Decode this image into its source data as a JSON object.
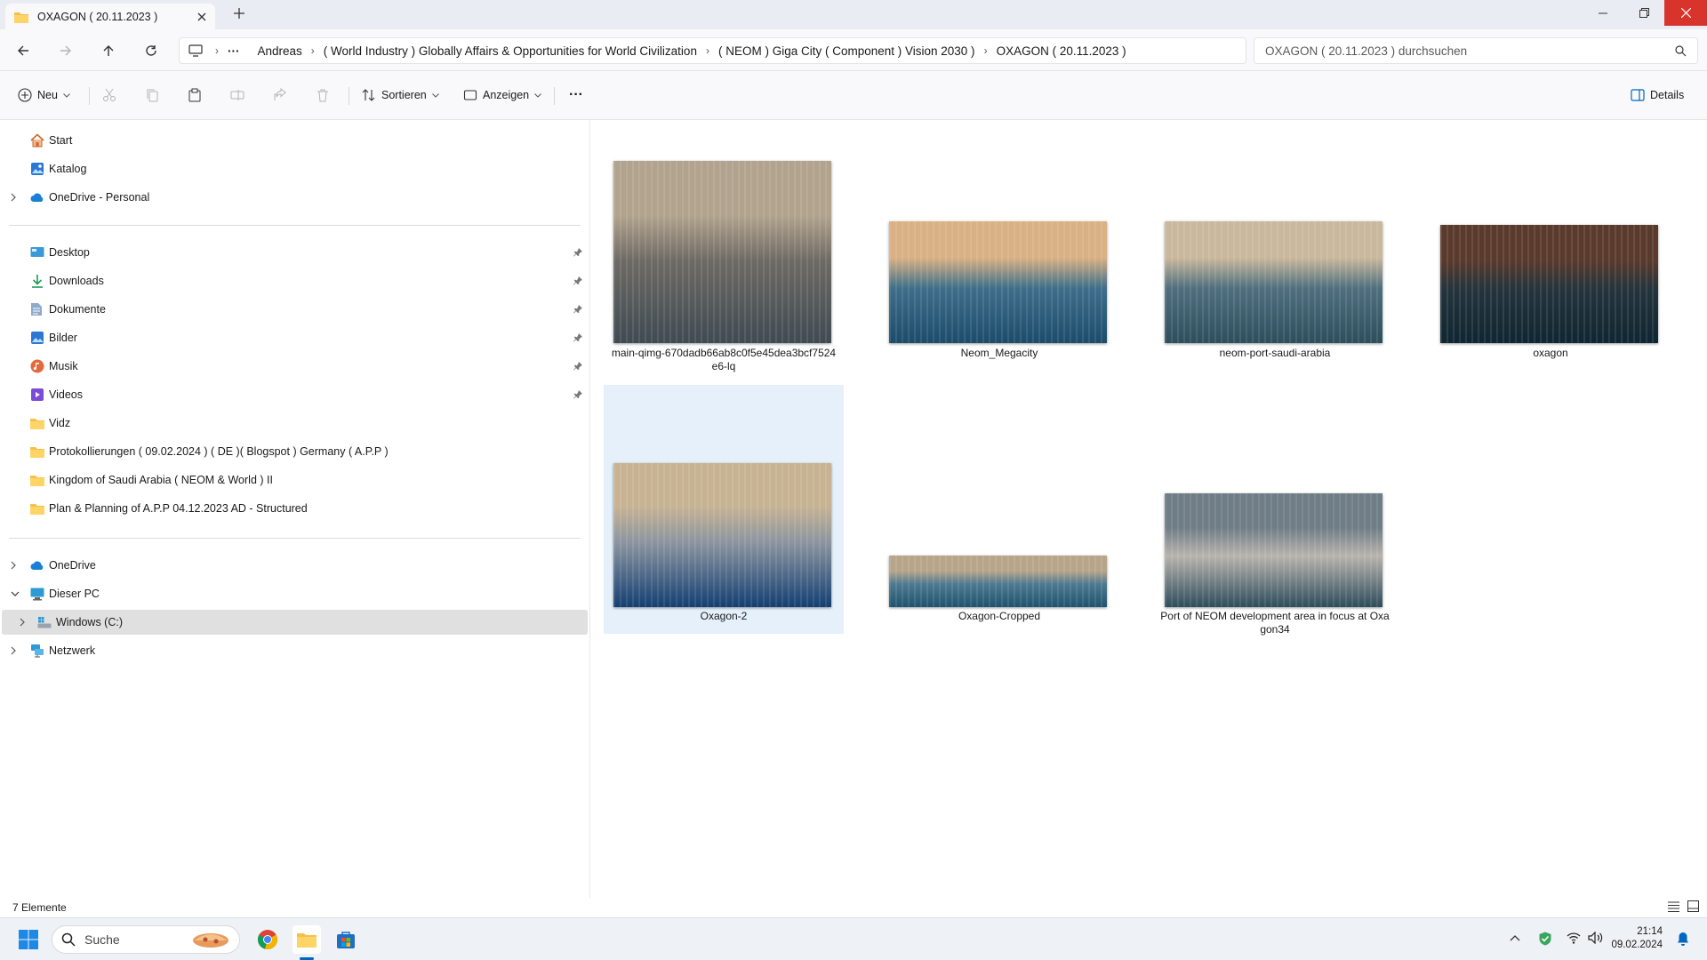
{
  "window": {
    "tab_title": "OXAGON ( 20.11.2023 )"
  },
  "breadcrumb": [
    "Andreas",
    "( World Industry ) Globally Affairs & Opportunities for World Civilization",
    "( NEOM ) Giga City ( Component ) Vision 2030 )",
    "OXAGON ( 20.11.2023 )"
  ],
  "search": {
    "placeholder": "OXAGON ( 20.11.2023 ) durchsuchen"
  },
  "toolbar": {
    "new_label": "Neu",
    "sort_label": "Sortieren",
    "view_label": "Anzeigen",
    "more_label": "···",
    "details_label": "Details"
  },
  "nav": {
    "top": [
      {
        "label": "Start"
      },
      {
        "label": "Katalog"
      },
      {
        "label": "OneDrive - Personal"
      }
    ],
    "pinned": [
      {
        "label": "Desktop"
      },
      {
        "label": "Downloads"
      },
      {
        "label": "Dokumente"
      },
      {
        "label": "Bilder"
      },
      {
        "label": "Musik"
      },
      {
        "label": "Videos"
      },
      {
        "label": "Vidz"
      },
      {
        "label": "Protokollierungen  ( 09.02.2024 ) ( DE )( Blogspot ) Germany ( A.P.P )"
      },
      {
        "label": "Kingdom of Saudi Arabia ( NEOM & World ) II"
      },
      {
        "label": "Plan  & Planning of A.P.P 04.12.2023 AD - Structured"
      }
    ],
    "locations": [
      {
        "label": "OneDrive"
      },
      {
        "label": "Dieser PC"
      },
      {
        "label": "Windows (C:)"
      },
      {
        "label": "Netzwerk"
      }
    ]
  },
  "files": [
    {
      "name": "main-qimg-670dadb66ab8c0f5e45dea3bcf7524e6-lq",
      "palette": [
        "#b2a38e",
        "#6d6a64",
        "#3f4a52"
      ]
    },
    {
      "name": "Neom_Megacity",
      "palette": [
        "#d9b184",
        "#3e6e8a",
        "#1b4c6a"
      ]
    },
    {
      "name": "neom-port-saudi-arabia",
      "palette": [
        "#c9b89c",
        "#4f6f7e",
        "#2d4e5c"
      ]
    },
    {
      "name": "oxagon",
      "palette": [
        "#5a3a2c",
        "#24343c",
        "#0f2632"
      ]
    },
    {
      "name": "Oxagon-2",
      "palette": [
        "#c7b393",
        "#8c95a0",
        "#143f72"
      ]
    },
    {
      "name": "Oxagon-Cropped",
      "palette": [
        "#b7a58a",
        "#4e7a90",
        "#1e5370"
      ]
    },
    {
      "name": "Port of NEOM development area in focus at Oxagon34",
      "palette": [
        "#6e7d86",
        "#b9b3ad",
        "#2d4d5c"
      ]
    }
  ],
  "status": {
    "count": "7 Elemente"
  },
  "taskbar": {
    "search_label": "Suche",
    "time": "21:14",
    "date": "09.02.2024"
  },
  "colors": {
    "accent": "#0067c0",
    "folder": "#f5c04a",
    "selection": "#e5f0fb"
  }
}
